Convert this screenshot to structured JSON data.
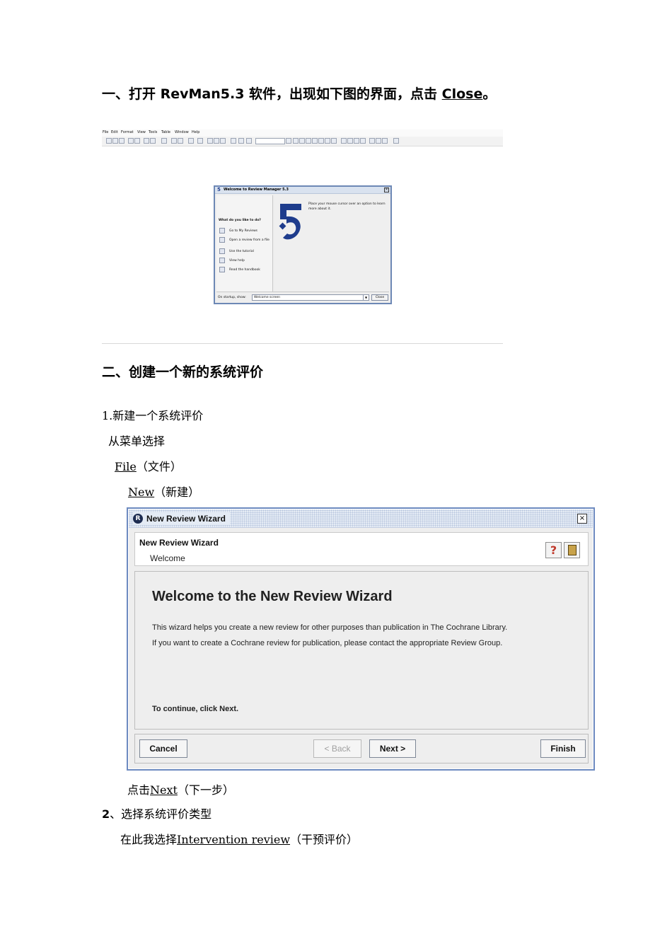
{
  "section1": {
    "heading_prefix": "一、打开 RevMan5.3 软件，出现如下图的界面，点击 ",
    "heading_link": "Close",
    "heading_suffix": "。"
  },
  "small_menubar": [
    "File",
    "Edit",
    "Format",
    "View",
    "Tools",
    "Table",
    "Window",
    "Help"
  ],
  "welcome_dialog": {
    "title": "Welcome to Review Manager 5.3",
    "question": "What do you like to do?",
    "options": [
      "Go to My Reviews",
      "Open a review from a file",
      "Use the tutorial",
      "View help",
      "Read the handbook"
    ],
    "hint_line1": "Place your mouse cursor over an option to learn",
    "hint_line2": "more about it.",
    "startup_label": "On startup, show:",
    "startup_value": "Welcome screen",
    "close_label": "Close"
  },
  "section2": {
    "heading": "二、创建一个新的系统评价",
    "step1": "1.新建一个系统评价",
    "menu_select": "从菜单选择",
    "file_link": "File",
    "file_suffix": "（文件）",
    "new_link": "New",
    "new_suffix": "（新建）",
    "click_prefix": "点击",
    "next_link": "Next",
    "click_suffix": "（下一步）",
    "step2_num": "2",
    "step2_text": "、选择系统评价类型",
    "choose_prefix": "在此我选择",
    "choose_link": "Intervention review",
    "choose_suffix": "（干预评价）"
  },
  "wizard": {
    "window_title": "New Review Wizard",
    "header_title": "New Review Wizard",
    "header_sub": "Welcome",
    "welcome_heading": "Welcome to the New Review Wizard",
    "line1": "This wizard helps you create a new review for other purposes than publication in The Cochrane Library.",
    "line2": "If you want to create a Cochrane review for publication, please contact the appropriate Review Group.",
    "continue_text": "To continue, click Next.",
    "buttons": {
      "cancel": "Cancel",
      "back": "< Back",
      "next": "Next >",
      "finish": "Finish"
    }
  }
}
